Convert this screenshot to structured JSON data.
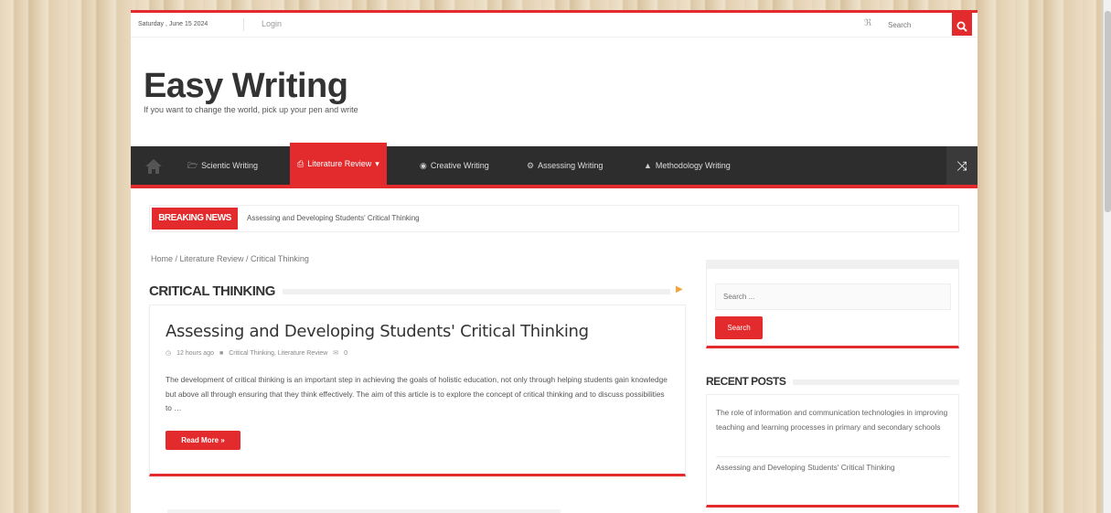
{
  "topbar": {
    "date": "Saturday , June 15 2024",
    "login": "Login",
    "search_placeholder": "Search"
  },
  "site": {
    "title": "Easy Writing",
    "tagline": "If you want to change the world, pick up your pen and write"
  },
  "nav": {
    "items": [
      {
        "label": "Scientic Writing",
        "icon": "folder-icon"
      },
      {
        "label": "Literature Review",
        "icon": "book-icon",
        "active": true,
        "caret": "▾"
      },
      {
        "label": "Creative Writing",
        "icon": "eye-icon"
      },
      {
        "label": "Assessing Writing",
        "icon": "gears-icon"
      },
      {
        "label": "Methodology Writing",
        "icon": "graduation-cap-icon"
      }
    ]
  },
  "breaking": {
    "label": "BREAKING NEWS",
    "text": "Assessing and Developing Students' Critical Thinking"
  },
  "breadcrumb": "Home / Literature Review / Critical Thinking",
  "category": {
    "title": "CRITICAL THINKING"
  },
  "post": {
    "title": "Assessing and Developing Students' Critical Thinking",
    "time": "12 hours ago",
    "categories": "Critical Thinking, Literature Review",
    "comments": "0",
    "excerpt": "The development of critical thinking is an important step in achieving the goals of holistic education, not only through helping students gain knowledge but above all through ensuring that they think effectively. The aim of this article is to explore the concept of critical thinking and to discuss possibilities to …",
    "read_more": "Read More »"
  },
  "sidebar": {
    "search_placeholder": "Search ...",
    "search_button": "Search",
    "recent_title": "RECENT POSTS",
    "recent": [
      "The role of information and communication technologies in improving teaching and learning processes in primary and secondary schools",
      "Assessing and Developing Students' Critical Thinking"
    ]
  },
  "colors": {
    "accent": "#e32b2d",
    "nav_bg": "#2d2d2d"
  }
}
